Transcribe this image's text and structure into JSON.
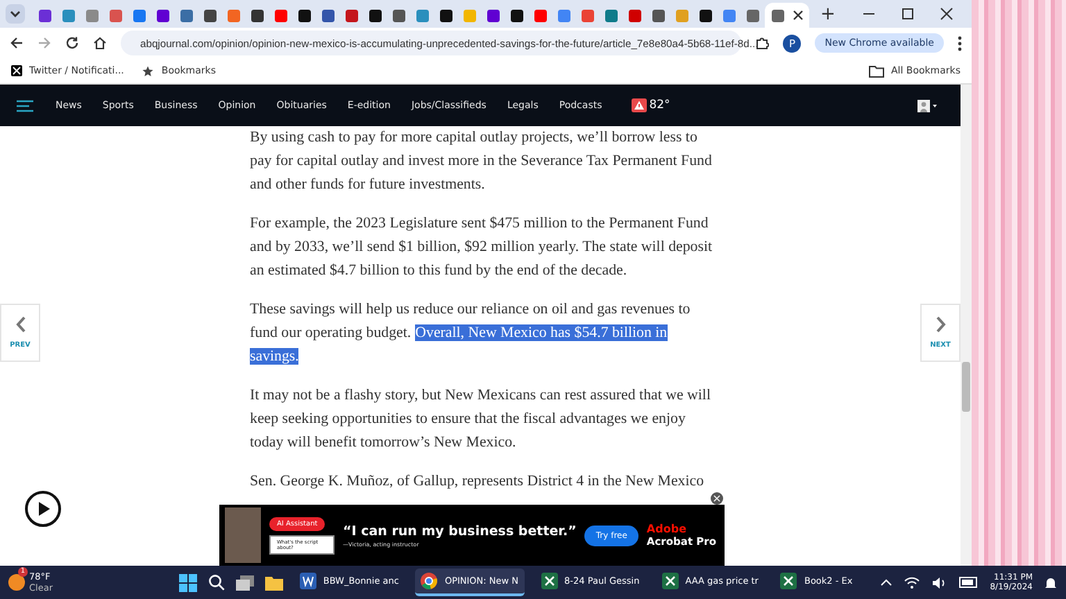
{
  "browser": {
    "tabs": [
      {
        "color": "#6b2fd6",
        "selected": false
      },
      {
        "color": "#2a8fbd",
        "selected": false
      },
      {
        "color": "#8a8a8a",
        "selected": false
      },
      {
        "color": "#d9534f",
        "selected": false
      },
      {
        "color": "#1877f2",
        "selected": false
      },
      {
        "color": "#6001d2",
        "selected": false
      },
      {
        "color": "#3b6ea5",
        "selected": false
      },
      {
        "color": "#444444",
        "selected": false
      },
      {
        "color": "#f26522",
        "selected": false
      },
      {
        "color": "#333333",
        "selected": false
      },
      {
        "color": "#ff0000",
        "selected": false
      },
      {
        "color": "#111111",
        "selected": false
      },
      {
        "color": "#3355aa",
        "selected": false
      },
      {
        "color": "#c4161c",
        "selected": false
      },
      {
        "color": "#111111",
        "selected": false
      },
      {
        "color": "#555555",
        "selected": false
      },
      {
        "color": "#2a8fbd",
        "selected": false
      },
      {
        "color": "#111111",
        "selected": false
      },
      {
        "color": "#f2b600",
        "selected": false
      },
      {
        "color": "#6001d2",
        "selected": false
      },
      {
        "color": "#111111",
        "selected": false
      },
      {
        "color": "#ff0000",
        "selected": false
      },
      {
        "color": "#4285f4",
        "selected": false
      },
      {
        "color": "#ea4335",
        "selected": false
      },
      {
        "color": "#0f7b8a",
        "selected": false
      },
      {
        "color": "#d00000",
        "selected": false
      },
      {
        "color": "#555555",
        "selected": false
      },
      {
        "color": "#e0a020",
        "selected": false
      },
      {
        "color": "#111111",
        "selected": false
      },
      {
        "color": "#4285f4",
        "selected": false
      },
      {
        "color": "#666666",
        "selected": false
      },
      {
        "color": "#666666",
        "selected": true
      }
    ],
    "new_tab": "+",
    "url": "abqjournal.com/opinion/opinion-new-mexico-is-accumulating-unprecedented-savings-for-the-future/article_7e8e80a4-5b68-11ef-8d...",
    "profile": "P",
    "update_button": "New Chrome available",
    "bookmarks": [
      "Twitter / Notificati...",
      "Bookmarks"
    ],
    "all_bookmarks": "All Bookmarks"
  },
  "site_nav": {
    "items": [
      "News",
      "Sports",
      "Business",
      "Opinion",
      "Obituaries",
      "E-edition",
      "Jobs/Classifieds",
      "Legals",
      "Podcasts"
    ],
    "temperature": "82°"
  },
  "article": {
    "paragraphs": [
      {
        "text": "By using cash to pay for more capital outlay projects, we’ll borrow less to pay for capital outlay and invest more in the Severance Tax Permanent Fund and other funds for future investments."
      },
      {
        "text": "For example, the 2023 Legislature sent $475 million to the Permanent Fund and by 2033, we’ll send $1 billion, $92 million yearly. The state will deposit an estimated $4.7 billion to this fund by the end of the decade."
      },
      {
        "text": "These savings will help us reduce our reliance on oil and gas revenues to fund our operating budget.",
        "selected_text": "Overall, New Mexico has $54.7 billion in savings."
      },
      {
        "text": "It may not be a flashy story, but New Mexicans can rest assured that we will keep seeking opportunities to ensure that the fiscal advantages we enjoy today will benefit tomorrow’s New Mexico."
      },
      {
        "text": "Sen. George K. Muñoz, of Gallup, represents District 4 in the New Mexico"
      }
    ],
    "prev": "PREV",
    "next": "NEXT"
  },
  "ad": {
    "badge": "AI Assistant",
    "field_placeholder": "What's the script about?",
    "quote": "“I can run my business better.”",
    "attribution": "—Victoria, acting instructor",
    "button": "Try free",
    "brand": "Adobe",
    "product": "Acrobat Pro",
    "close": "×"
  },
  "taskbar": {
    "weather": {
      "temp": "78°F",
      "condition": "Clear",
      "alerts": "1"
    },
    "apps": [
      {
        "label": "BBW_Bonnie anc",
        "kind": "word",
        "selected": false
      },
      {
        "label": "OPINION: New N",
        "kind": "chrome",
        "selected": true
      },
      {
        "label": "8-24 Paul Gessin",
        "kind": "excel",
        "selected": false
      },
      {
        "label": "AAA gas price tr",
        "kind": "excel",
        "selected": false
      },
      {
        "label": "Book2 - Ex",
        "kind": "excel",
        "selected": false
      }
    ],
    "time": "11:31 PM",
    "date": "8/19/2024"
  }
}
